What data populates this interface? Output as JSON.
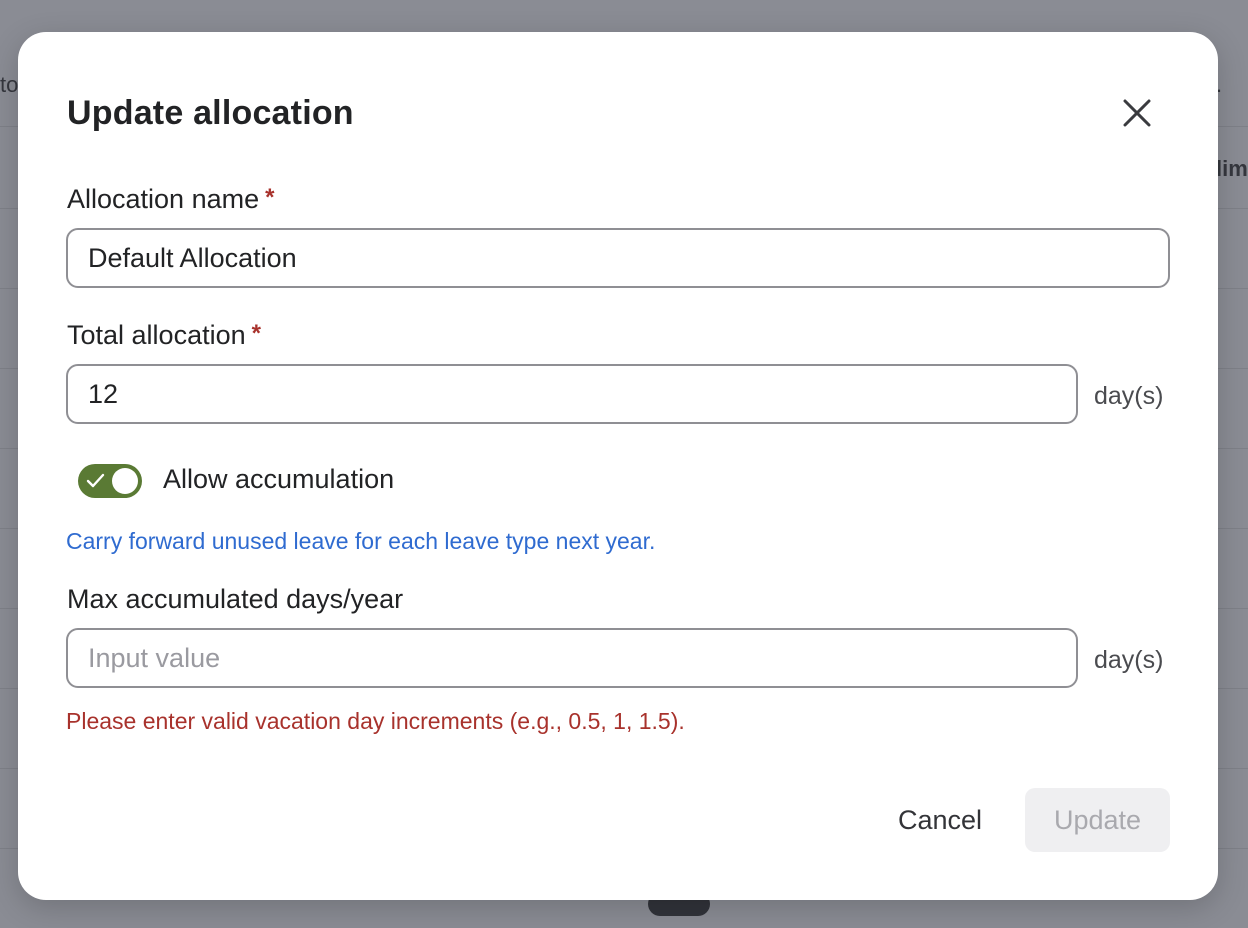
{
  "background": {
    "left_fragment": "to",
    "right_fragment": ".",
    "column_fragment": "lim"
  },
  "modal": {
    "title": "Update allocation",
    "close_icon": "close-icon",
    "allocation_name": {
      "label": "Allocation name",
      "required_mark": "*",
      "value": "Default Allocation"
    },
    "total_allocation": {
      "label": "Total allocation",
      "required_mark": "*",
      "value": "12",
      "unit": "day(s)"
    },
    "accumulation": {
      "toggle_on": true,
      "label": "Allow accumulation",
      "helper": "Carry forward unused leave for each leave type next year."
    },
    "max_accumulated": {
      "label": "Max accumulated days/year",
      "value": "",
      "placeholder": "Input value",
      "unit": "day(s)",
      "error": "Please enter valid vacation day increments (e.g., 0.5, 1, 1.5)."
    },
    "actions": {
      "cancel_label": "Cancel",
      "update_label": "Update",
      "update_disabled": true
    },
    "colors": {
      "toggle_on": "#5a7a34",
      "helper_text": "#2f6bd0",
      "error_text": "#a8322c",
      "required_mark": "#a8322c"
    }
  }
}
